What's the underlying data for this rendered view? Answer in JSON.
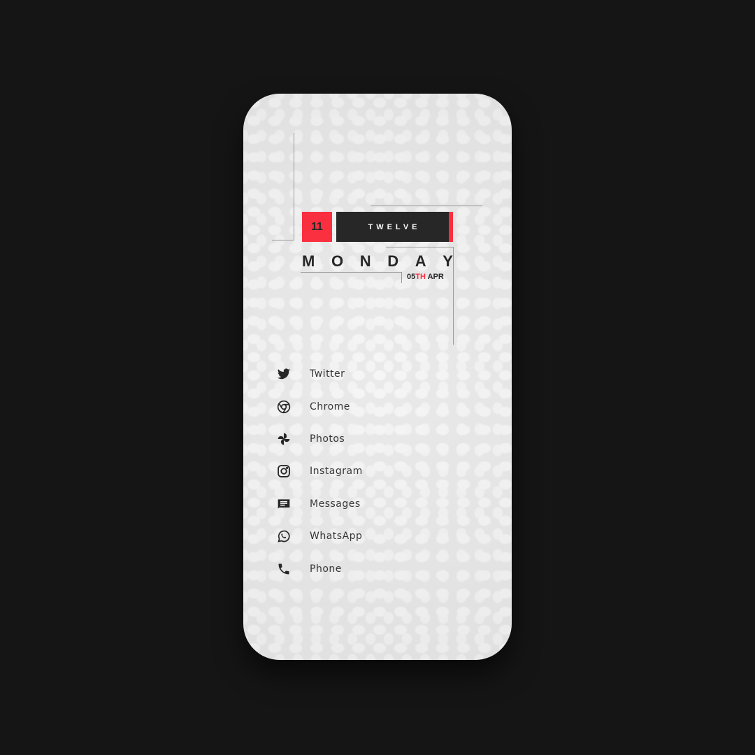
{
  "clock": {
    "hour": "11",
    "minute_word": "TWELVE",
    "day_letters": [
      "M",
      "O",
      "N",
      "D",
      "A",
      "Y"
    ],
    "date_num": "05",
    "date_suffix": "TH",
    "month": "APR"
  },
  "colors": {
    "accent": "#ff0a1e",
    "dark": "#000000"
  },
  "apps": [
    {
      "label": "Twitter",
      "icon": "twitter-icon"
    },
    {
      "label": "Chrome",
      "icon": "chrome-icon"
    },
    {
      "label": "Photos",
      "icon": "photos-icon"
    },
    {
      "label": "Instagram",
      "icon": "instagram-icon"
    },
    {
      "label": "Messages",
      "icon": "messages-icon"
    },
    {
      "label": "WhatsApp",
      "icon": "whatsapp-icon"
    },
    {
      "label": "Phone",
      "icon": "phone-icon"
    }
  ]
}
